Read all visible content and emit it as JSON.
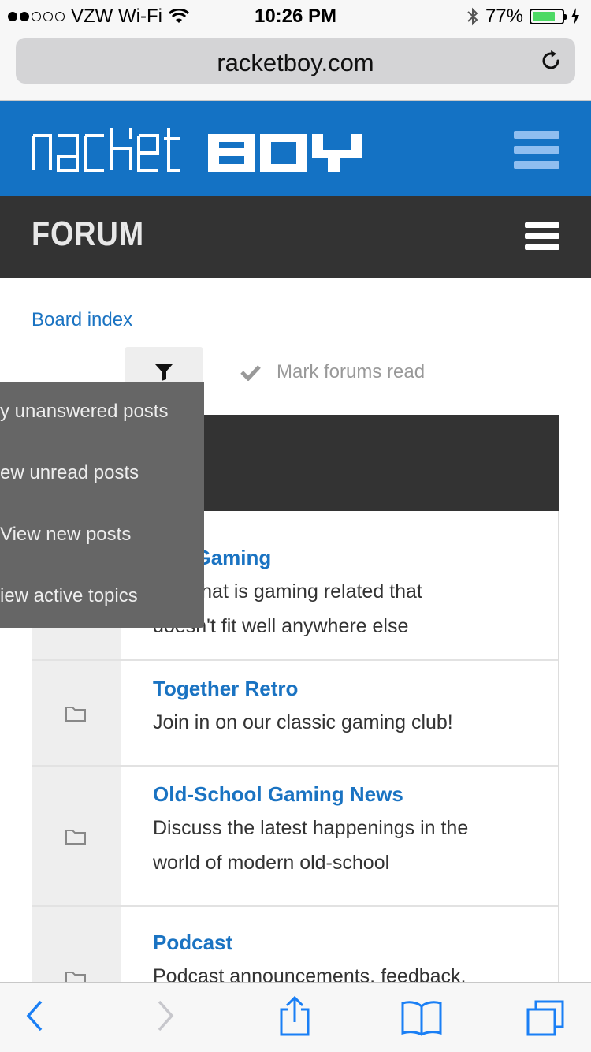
{
  "status_bar": {
    "carrier": "VZW Wi-Fi",
    "time": "10:26 PM",
    "battery": "77%"
  },
  "browser": {
    "url": "racketboy.com"
  },
  "site": {
    "logo_text": "racketBOY"
  },
  "forum_bar": {
    "title": "FORUM"
  },
  "breadcrumb": "Board index",
  "actions": {
    "mark_read": "Mark forums read"
  },
  "dropdown": {
    "items": [
      "y unanswered posts",
      "ew unread posts",
      "View new posts",
      "iew active topics"
    ]
  },
  "forums": [
    {
      "title": "eral Gaming",
      "desc_line1": "hing that is gaming related that",
      "desc_line2": "doesn't fit well anywhere else"
    },
    {
      "title": "Together Retro",
      "desc_line1": "Join in on our classic gaming club!",
      "desc_line2": ""
    },
    {
      "title": "Old-School Gaming News",
      "desc_line1": "Discuss the latest happenings in the",
      "desc_line2": "world of modern old-school"
    },
    {
      "title": "Podcast",
      "desc_line1": "Podcast announcements, feedback,",
      "desc_line2": ""
    }
  ],
  "colors": {
    "header_blue": "#1472c4",
    "forum_bar": "#333333",
    "link": "#1a73c2",
    "dropdown_bg": "#666666",
    "toolbar_blue": "#1a7ff5"
  },
  "icons": [
    "wifi-icon",
    "bluetooth-icon",
    "charging-icon",
    "reload-icon",
    "hamburger-icon",
    "filter-icon",
    "check-icon",
    "folder-icon",
    "back-icon",
    "forward-icon",
    "share-icon",
    "bookmarks-icon",
    "tabs-icon"
  ]
}
